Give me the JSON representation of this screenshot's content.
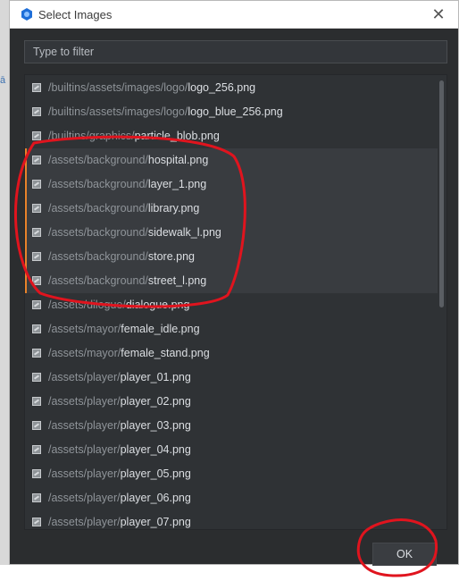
{
  "window": {
    "title": "Select Images",
    "close_icon": "close-icon"
  },
  "filter": {
    "placeholder": "Type to filter"
  },
  "files": [
    {
      "dir": "/builtins/assets/images/logo/",
      "name": "logo_256.png",
      "selected": false
    },
    {
      "dir": "/builtins/assets/images/logo/",
      "name": "logo_blue_256.png",
      "selected": false
    },
    {
      "dir": "/builtins/graphics/",
      "name": "particle_blob.png",
      "selected": false
    },
    {
      "dir": "/assets/background/",
      "name": "hospital.png",
      "selected": true
    },
    {
      "dir": "/assets/background/",
      "name": "layer_1.png",
      "selected": true
    },
    {
      "dir": "/assets/background/",
      "name": "library.png",
      "selected": true
    },
    {
      "dir": "/assets/background/",
      "name": "sidewalk_l.png",
      "selected": true
    },
    {
      "dir": "/assets/background/",
      "name": "store.png",
      "selected": true
    },
    {
      "dir": "/assets/background/",
      "name": "street_l.png",
      "selected": true
    },
    {
      "dir": "/assets/dilogue/",
      "name": "dialogue.png",
      "selected": false
    },
    {
      "dir": "/assets/mayor/",
      "name": "female_idle.png",
      "selected": false
    },
    {
      "dir": "/assets/mayor/",
      "name": "female_stand.png",
      "selected": false
    },
    {
      "dir": "/assets/player/",
      "name": "player_01.png",
      "selected": false
    },
    {
      "dir": "/assets/player/",
      "name": "player_02.png",
      "selected": false
    },
    {
      "dir": "/assets/player/",
      "name": "player_03.png",
      "selected": false
    },
    {
      "dir": "/assets/player/",
      "name": "player_04.png",
      "selected": false
    },
    {
      "dir": "/assets/player/",
      "name": "player_05.png",
      "selected": false
    },
    {
      "dir": "/assets/player/",
      "name": "player_06.png",
      "selected": false
    },
    {
      "dir": "/assets/player/",
      "name": "player_07.png",
      "selected": false
    }
  ],
  "actions": {
    "ok_label": "OK"
  },
  "colors": {
    "selection_accent": "#e8822a",
    "annotation": "#e0141e",
    "dialog_bg": "#2b2d2f"
  }
}
